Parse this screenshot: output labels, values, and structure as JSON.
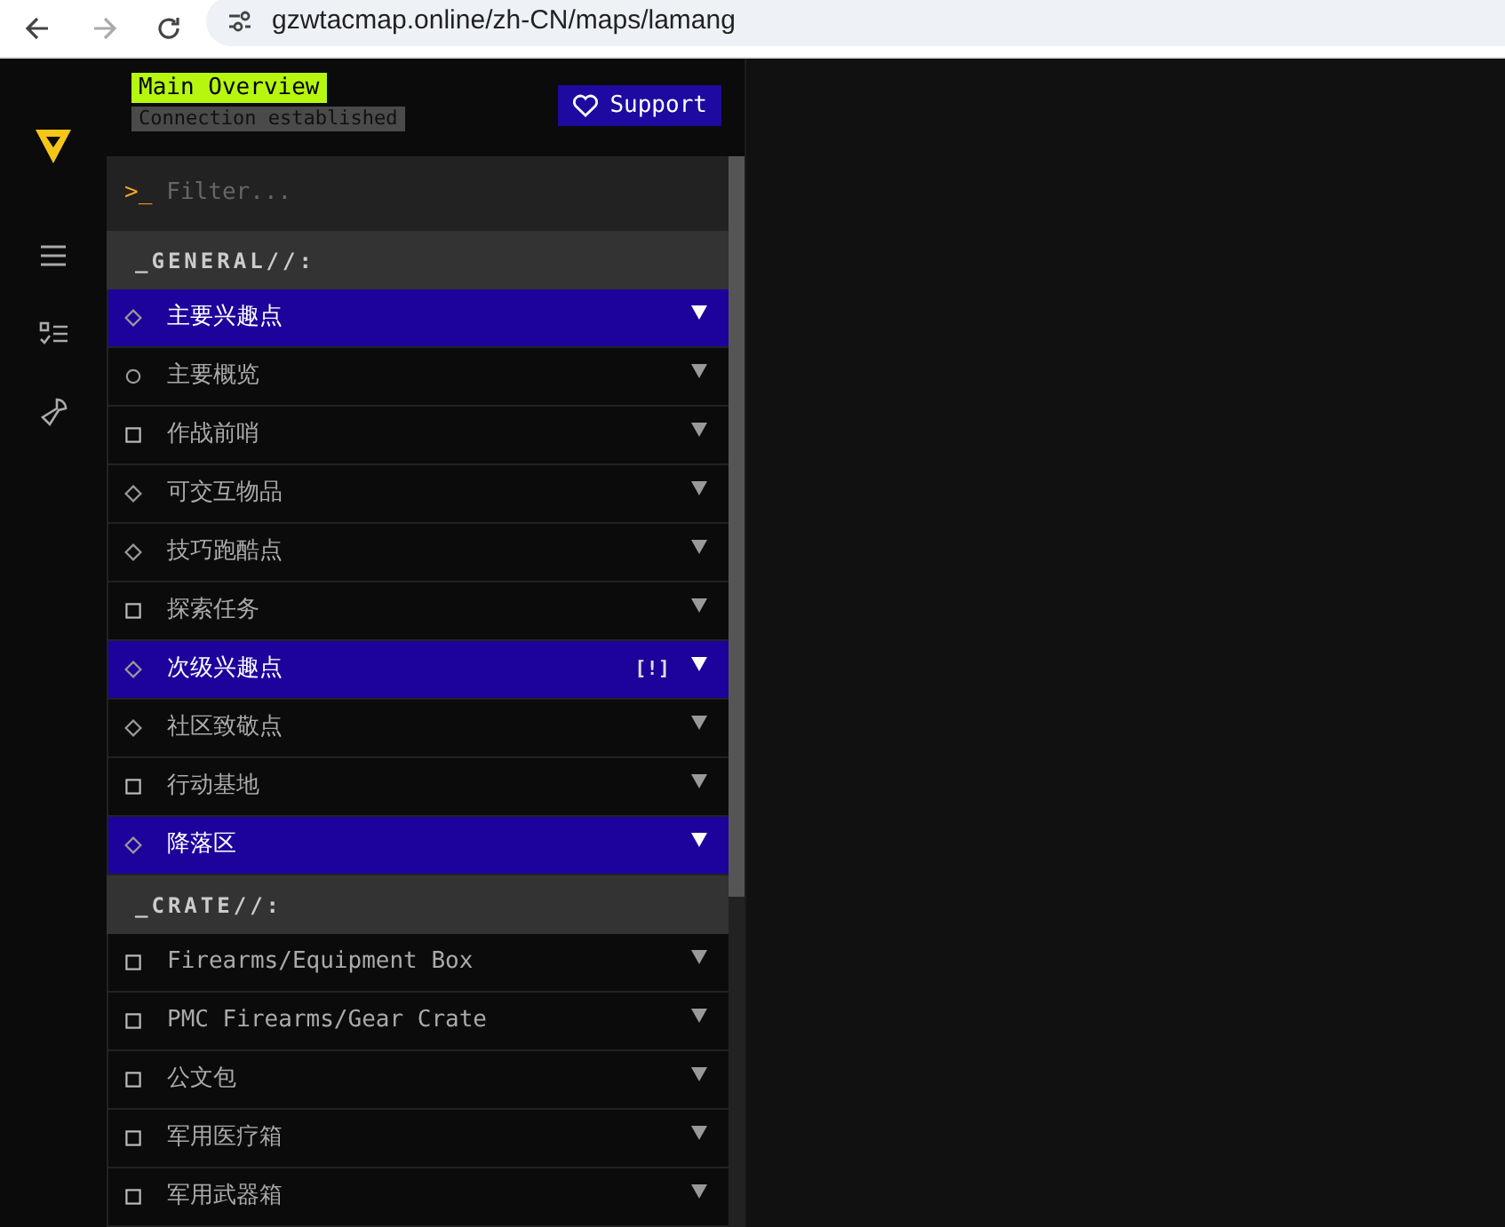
{
  "browser": {
    "url": "gzwtacmap.online/zh-CN/maps/lamang"
  },
  "header": {
    "title": "Main Overview",
    "status": "Connection established",
    "support_button": "Support"
  },
  "filter": {
    "prompt": ">_",
    "placeholder": "Filter..."
  },
  "sections": [
    {
      "title": "_GENERAL//:",
      "items": [
        {
          "label": "主要兴趣点",
          "kind": "diamond",
          "selected": true
        },
        {
          "label": "主要概览",
          "kind": "circle",
          "selected": false
        },
        {
          "label": "作战前哨",
          "kind": "square",
          "selected": false
        },
        {
          "label": "可交互物品",
          "kind": "diamond",
          "selected": false
        },
        {
          "label": "技巧跑酷点",
          "kind": "diamond",
          "selected": false
        },
        {
          "label": "探索任务",
          "kind": "square",
          "selected": false
        },
        {
          "label": "次级兴趣点",
          "kind": "diamond",
          "selected": true,
          "badge": "[!]"
        },
        {
          "label": "社区致敬点",
          "kind": "diamond",
          "selected": false
        },
        {
          "label": "行动基地",
          "kind": "square",
          "selected": false
        },
        {
          "label": "降落区",
          "kind": "diamond",
          "selected": true
        }
      ]
    },
    {
      "title": "_CRATE//:",
      "items": [
        {
          "label": "Firearms/Equipment Box",
          "kind": "square",
          "selected": false
        },
        {
          "label": "PMC Firearms/Gear Crate",
          "kind": "square",
          "selected": false
        },
        {
          "label": "公文包",
          "kind": "square",
          "selected": false
        },
        {
          "label": "军用医疗箱",
          "kind": "square",
          "selected": false
        },
        {
          "label": "军用武器箱",
          "kind": "square",
          "selected": false
        }
      ]
    }
  ]
}
